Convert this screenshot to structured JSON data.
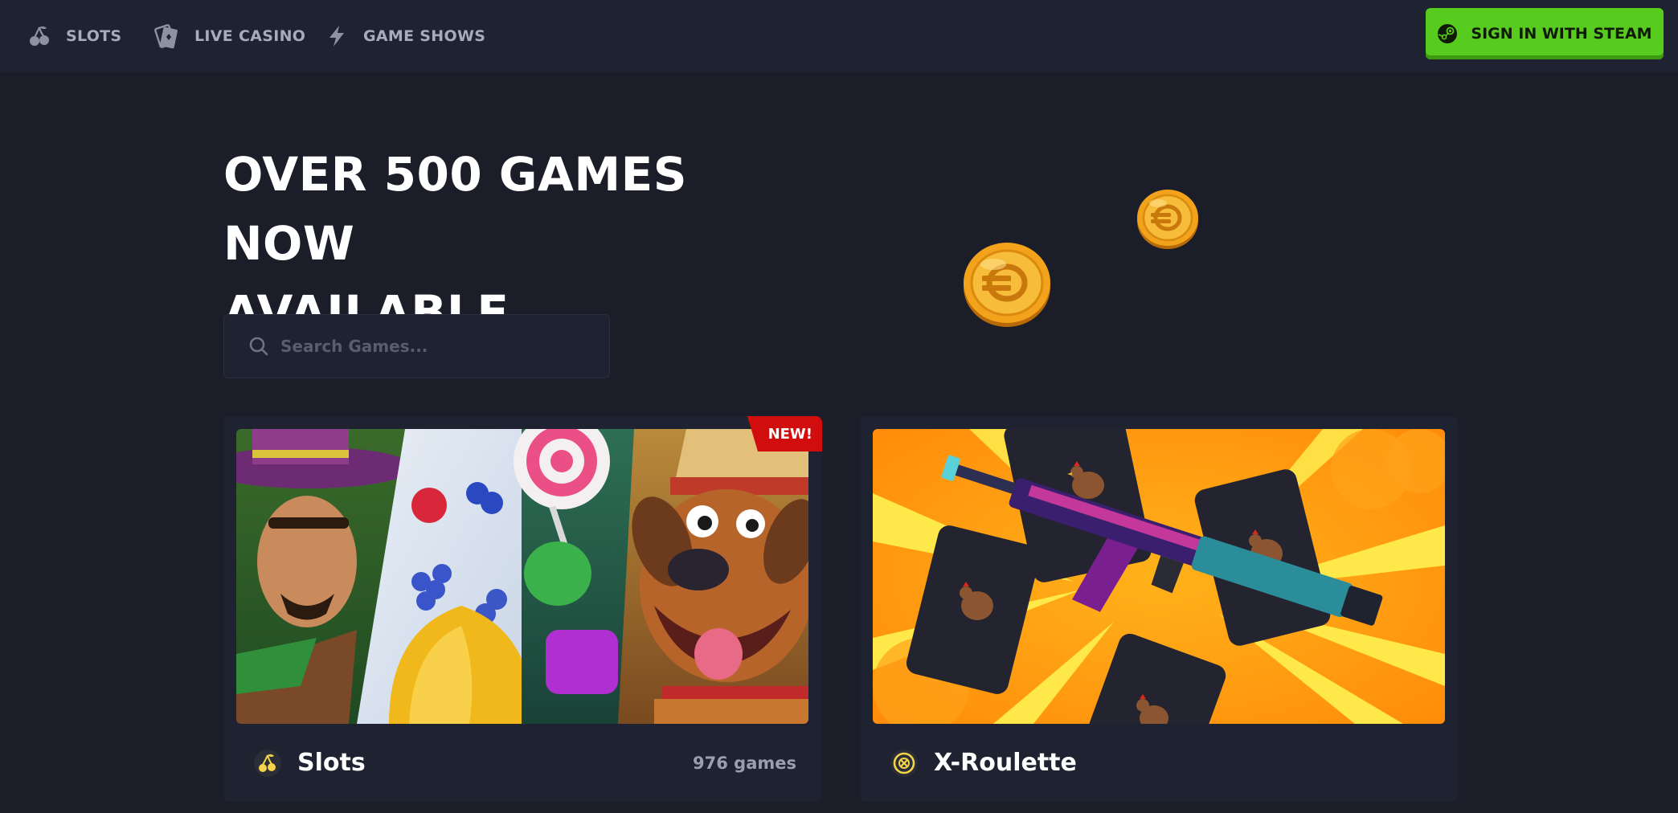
{
  "nav": {
    "items": [
      {
        "label": "SLOTS",
        "icon": "cherries-icon"
      },
      {
        "label": "LIVE CASINO",
        "icon": "cards-icon"
      },
      {
        "label": "GAME SHOWS",
        "icon": "lightning-icon"
      }
    ],
    "steam_button": {
      "label": "SIGN IN WITH STEAM",
      "icon": "steam-icon",
      "color": "#58cb1f"
    }
  },
  "hero": {
    "title_line1": "OVER 500 GAMES NOW",
    "title_line2": "AVAILABLE"
  },
  "search": {
    "placeholder": "Search Games...",
    "value": ""
  },
  "cards": [
    {
      "title": "Slots",
      "count": "976 games",
      "badge": "NEW!",
      "icon": "cherries-icon"
    },
    {
      "title": "X-Roulette",
      "icon": "roulette-icon"
    }
  ],
  "colors": {
    "background": "#1b1d29",
    "panel": "#1f2230",
    "accent_green": "#58cb1f",
    "badge_red": "#d10d0d",
    "coin_gold": "#f2a31b"
  }
}
